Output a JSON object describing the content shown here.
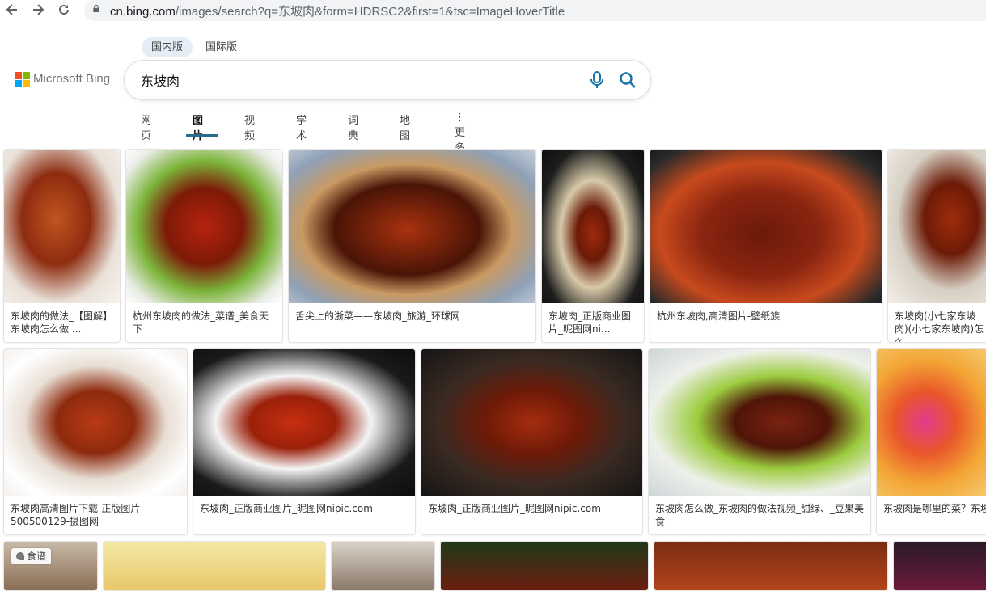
{
  "browser": {
    "back_icon": "back-arrow-icon",
    "forward_icon": "forward-arrow-icon",
    "reload_icon": "reload-icon",
    "url_host": "cn.bing.com",
    "url_path": "/images/search?q=东坡肉&form=HDRSC2&first=1&tsc=ImageHoverTitle"
  },
  "header": {
    "market_tabs": [
      {
        "label": "国内版",
        "active": true
      },
      {
        "label": "国际版",
        "active": false
      }
    ],
    "logo_text": "Microsoft Bing",
    "search_value": "东坡肉",
    "scopes": [
      {
        "label": "网页"
      },
      {
        "label": "图片",
        "active": true
      },
      {
        "label": "视频"
      },
      {
        "label": "学术"
      },
      {
        "label": "词典"
      },
      {
        "label": "地图"
      },
      {
        "label": "⋮ 更多"
      }
    ],
    "accent_color": "#2a6b8f"
  },
  "results": {
    "row1": [
      {
        "caption": "东坡肉的做法_【图解】东坡肉怎么做 ..."
      },
      {
        "caption": "杭州东坡肉的做法_菜谱_美食天下"
      },
      {
        "caption": "舌尖上的浙菜——东坡肉_旅游_环球网"
      },
      {
        "caption": "东坡肉_正版商业图片_昵图网ni..."
      },
      {
        "caption": "杭州东坡肉,高清图片-壁纸族"
      },
      {
        "caption": "东坡肉(小七家东坡肉)(小七家东坡肉)怎么 ..."
      }
    ],
    "row2": [
      {
        "caption": "东坡肉高清图片下载-正版图片500500129-摄图网"
      },
      {
        "caption": "东坡肉_正版商业图片_昵图网nipic.com"
      },
      {
        "caption": "东坡肉_正版商业图片_昵图网nipic.com"
      },
      {
        "caption": "东坡肉怎么做_东坡肉的做法视频_甜绿、_豆果美食"
      },
      {
        "caption": "东坡肉是哪里的菜？东坡"
      }
    ],
    "food_tag": "食谱"
  }
}
